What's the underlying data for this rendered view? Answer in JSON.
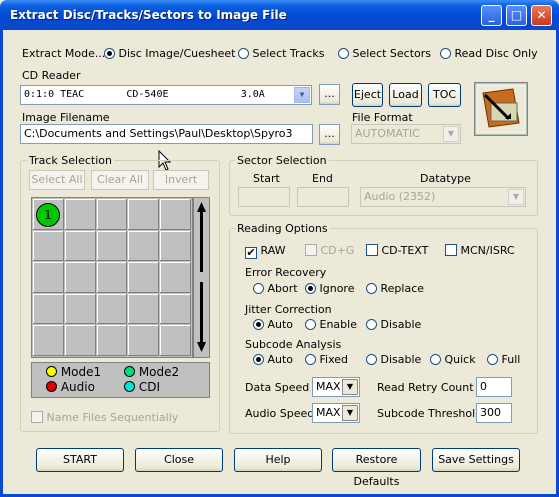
{
  "window": {
    "title": "Extract Disc/Tracks/Sectors to Image File"
  },
  "extract_mode": {
    "label": "Extract Mode...",
    "options": [
      "Disc Image/Cuesheet",
      "Select Tracks",
      "Select Sectors",
      "Read Disc Only"
    ],
    "selected": "Disc Image/Cuesheet"
  },
  "cd_reader": {
    "label": "CD Reader",
    "value": "0:1:0 TEAC       CD-540E            3.0A",
    "browse": "...",
    "eject": "Eject",
    "load": "Load",
    "toc": "TOC"
  },
  "image_filename": {
    "label": "Image Filename",
    "value": "C:\\Documents and Settings\\Paul\\Desktop\\Spyro3",
    "browse": "..."
  },
  "file_format": {
    "label": "File Format",
    "value": "AUTOMATIC"
  },
  "track_selection": {
    "label": "Track Selection",
    "select_all": "Select All",
    "clear_all": "Clear All",
    "invert": "Invert",
    "track1": "1",
    "legend": {
      "mode1": "Mode1",
      "mode2": "Mode2",
      "audio": "Audio",
      "cdi": "CDI"
    },
    "name_files": "Name Files Sequentially"
  },
  "sector_selection": {
    "label": "Sector Selection",
    "start": "Start",
    "end": "End",
    "datatype": "Datatype",
    "datatype_value": "Audio (2352)"
  },
  "reading_options": {
    "label": "Reading Options",
    "raw": "RAW",
    "cdg": "CD+G",
    "cdtext": "CD-TEXT",
    "mcn": "MCN/ISRC",
    "error_recovery": {
      "label": "Error Recovery",
      "options": [
        "Abort",
        "Ignore",
        "Replace"
      ],
      "selected": "Ignore"
    },
    "jitter": {
      "label": "Jitter Correction",
      "options": [
        "Auto",
        "Enable",
        "Disable"
      ],
      "selected": "Auto"
    },
    "subcode": {
      "label": "Subcode Analysis",
      "options": [
        "Auto",
        "Fixed",
        "Disable",
        "Quick",
        "Full"
      ],
      "selected": "Auto"
    },
    "data_speed": {
      "label": "Data Speed",
      "value": "MAX"
    },
    "audio_speed": {
      "label": "Audio Speed",
      "value": "MAX"
    },
    "retry": {
      "label": "Read Retry Count",
      "value": "0"
    },
    "subcode_threshold": {
      "label": "Subcode Threshold",
      "value": "300"
    }
  },
  "buttons": {
    "start": "START",
    "close": "Close",
    "help": "Help",
    "restore": "Restore Defaults",
    "save": "Save Settings"
  },
  "colors": {
    "mode1": "#ffff00",
    "mode2": "#00e07a",
    "audio": "#e00000",
    "cdi": "#00e8d8",
    "track1": "#00c800"
  }
}
